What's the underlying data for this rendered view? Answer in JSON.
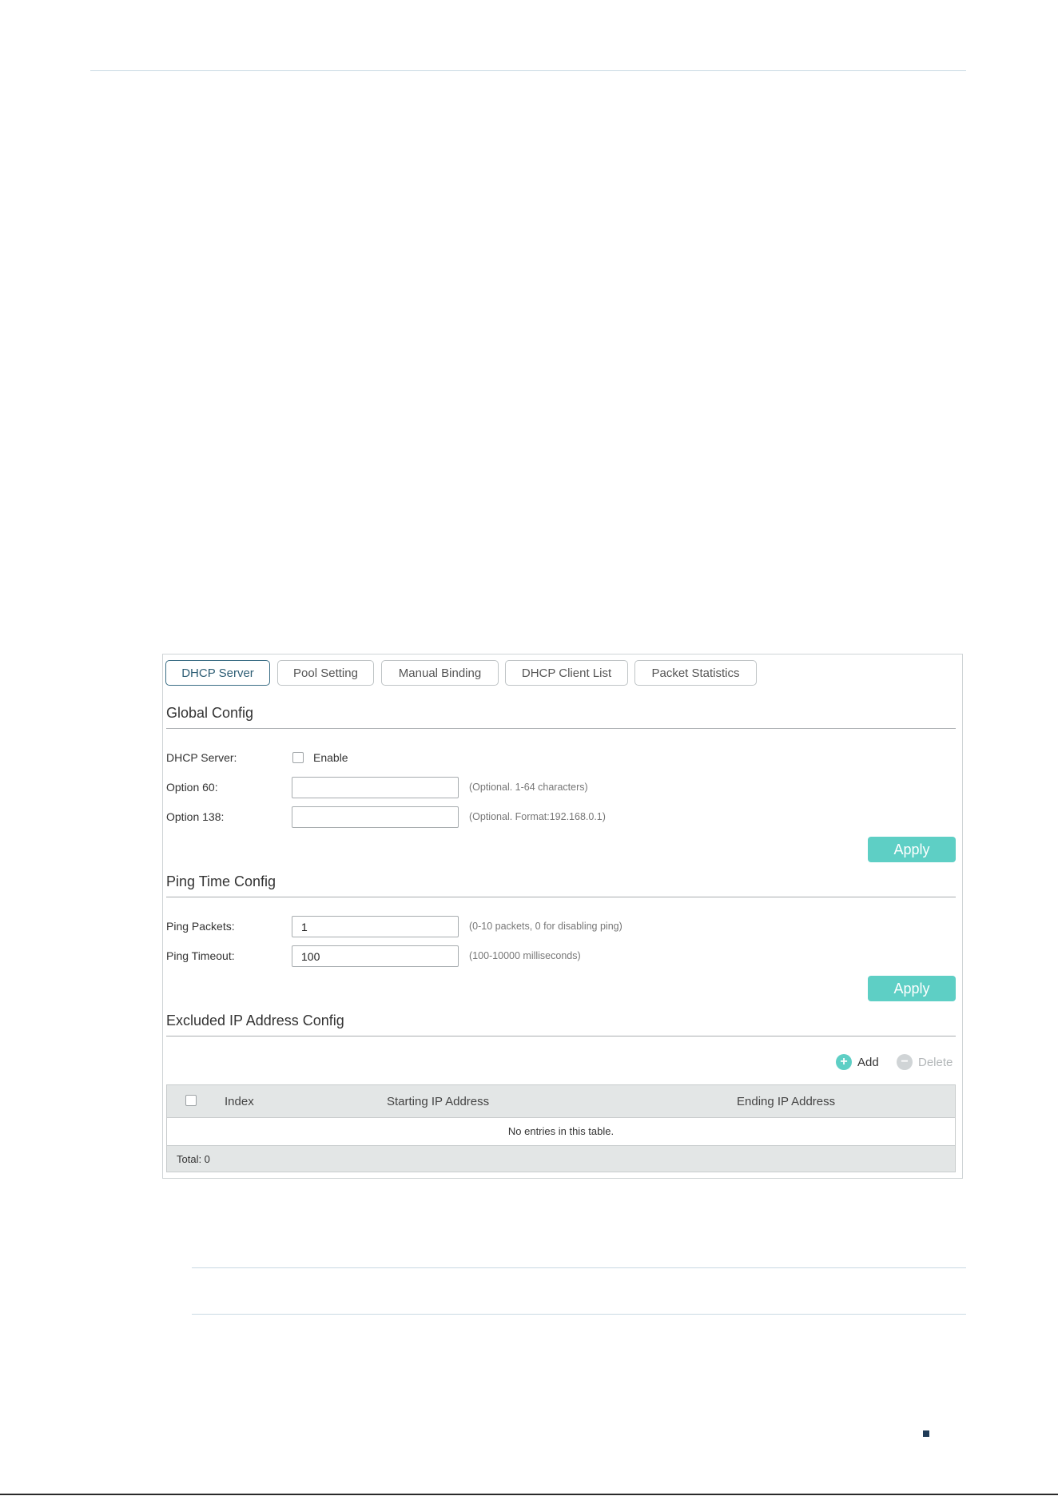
{
  "tabs": [
    {
      "label": "DHCP Server",
      "active": true
    },
    {
      "label": "Pool Setting",
      "active": false
    },
    {
      "label": "Manual Binding",
      "active": false
    },
    {
      "label": "DHCP Client List",
      "active": false
    },
    {
      "label": "Packet Statistics",
      "active": false
    }
  ],
  "global_config": {
    "title": "Global Config",
    "dhcp_server_label": "DHCP Server:",
    "enable_label": "Enable",
    "enable_checked": false,
    "option60_label": "Option 60:",
    "option60_value": "",
    "option60_hint": "(Optional. 1-64 characters)",
    "option138_label": "Option 138:",
    "option138_value": "",
    "option138_hint": "(Optional. Format:192.168.0.1)",
    "apply_label": "Apply"
  },
  "ping_config": {
    "title": "Ping Time Config",
    "packets_label": "Ping Packets:",
    "packets_value": "1",
    "packets_hint": "(0-10 packets, 0 for disabling ping)",
    "timeout_label": "Ping Timeout:",
    "timeout_value": "100",
    "timeout_hint": "(100-10000 milliseconds)",
    "apply_label": "Apply"
  },
  "excluded_config": {
    "title": "Excluded IP Address Config",
    "add_label": "Add",
    "delete_label": "Delete",
    "columns": [
      "Index",
      "Starting IP Address",
      "Ending IP Address"
    ],
    "empty_text": "No entries in this table.",
    "total_text": "Total: 0"
  },
  "colors": {
    "accent": "#5ecfc5",
    "active_tab": "#3b6e85",
    "add_icon": "#5ecfc5",
    "delete_icon": "#d0d4d6"
  },
  "icons": [
    "add-circle-icon",
    "delete-circle-icon"
  ]
}
